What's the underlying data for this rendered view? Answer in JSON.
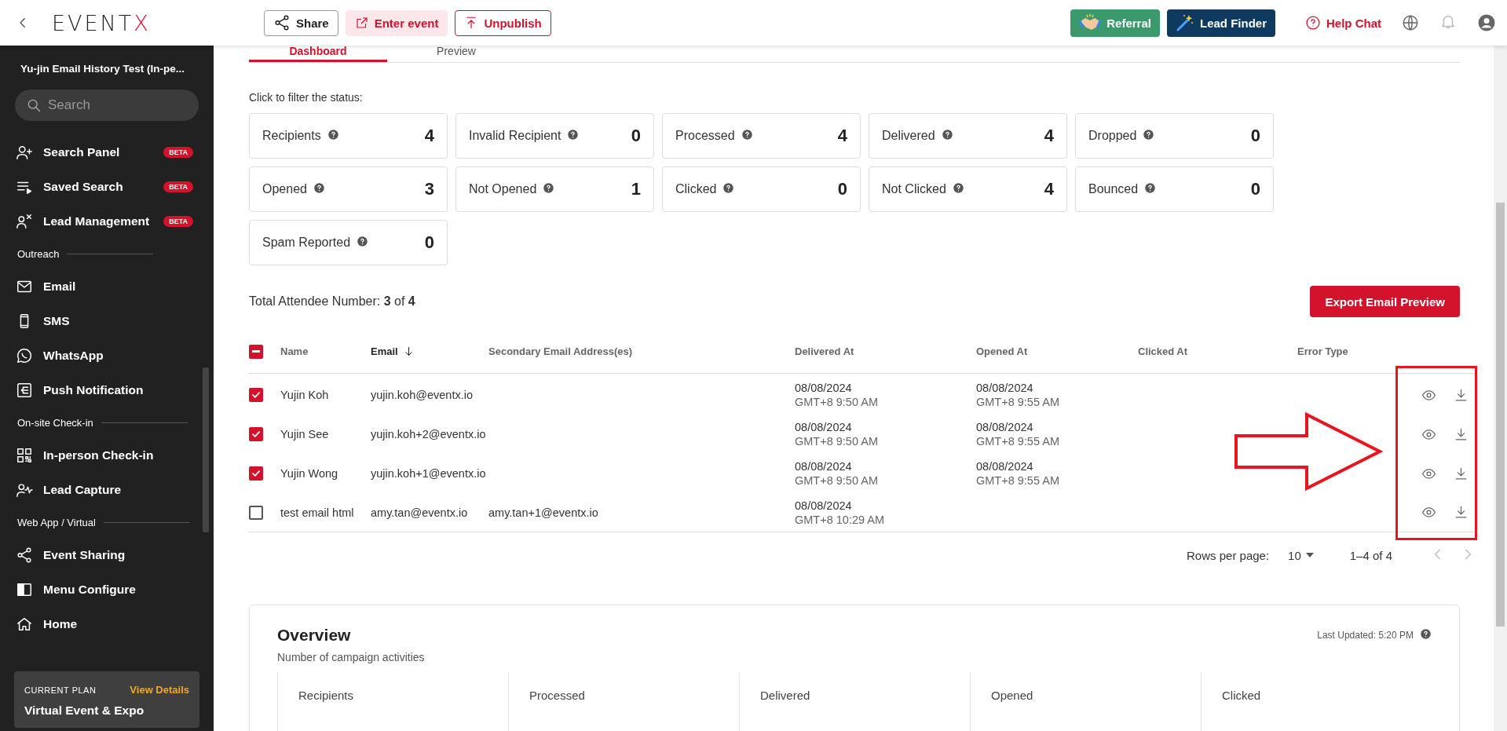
{
  "header": {
    "logo": {
      "text": "EVENT",
      "accent": "X"
    },
    "actions": [
      {
        "label": "Share",
        "kind": "outline"
      },
      {
        "label": "Enter event",
        "kind": "tinted"
      },
      {
        "label": "Unpublish",
        "kind": "danger-outline"
      }
    ],
    "promos": [
      {
        "label": "Referral",
        "kind": "green"
      },
      {
        "label": "Lead Finder",
        "kind": "navy"
      }
    ],
    "help": "Help Chat"
  },
  "sidebar": {
    "event_title": "Yu-jin Email History Test (In-pe...",
    "search": {
      "placeholder": "Search"
    },
    "items": [
      {
        "kind": "item",
        "label": "Search Panel",
        "badge": "BETA"
      },
      {
        "kind": "item",
        "label": "Saved Search",
        "badge": "BETA"
      },
      {
        "kind": "item",
        "label": "Lead Management",
        "badge": "BETA"
      },
      {
        "kind": "section",
        "label": "Outreach"
      },
      {
        "kind": "item",
        "label": "Email"
      },
      {
        "kind": "item",
        "label": "SMS"
      },
      {
        "kind": "item",
        "label": "WhatsApp"
      },
      {
        "kind": "item",
        "label": "Push Notification"
      },
      {
        "kind": "section",
        "label": "On-site Check-in"
      },
      {
        "kind": "item",
        "label": "In-person Check-in"
      },
      {
        "kind": "item",
        "label": "Lead Capture"
      },
      {
        "kind": "section",
        "label": "Web App / Virtual"
      },
      {
        "kind": "item",
        "label": "Event Sharing"
      },
      {
        "kind": "item",
        "label": "Menu Configure"
      },
      {
        "kind": "item",
        "label": "Home"
      }
    ],
    "plan": {
      "caption": "CURRENT PLAN",
      "link": "View Details",
      "name": "Virtual Event & Expo"
    }
  },
  "tabs": [
    {
      "label": "Dashboard",
      "selected": true
    },
    {
      "label": "Preview",
      "selected": false
    }
  ],
  "filter_hint": "Click to filter the status:",
  "stats": [
    {
      "label": "Recipients",
      "value": "4"
    },
    {
      "label": "Invalid Recipient",
      "value": "0"
    },
    {
      "label": "Processed",
      "value": "4"
    },
    {
      "label": "Delivered",
      "value": "4"
    },
    {
      "label": "Dropped",
      "value": "0"
    },
    {
      "label": "Opened",
      "value": "3"
    },
    {
      "label": "Not Opened",
      "value": "1"
    },
    {
      "label": "Clicked",
      "value": "0"
    },
    {
      "label": "Not Clicked",
      "value": "4"
    },
    {
      "label": "Bounced",
      "value": "0"
    },
    {
      "label": "Spam Reported",
      "value": "0"
    }
  ],
  "total": "Total Attendee Number: **3** of **4**",
  "export_button": "Export Email Preview",
  "table": {
    "select_all": {
      "checked": true,
      "partial": true
    },
    "columns": [
      {
        "label": "Name",
        "sorted": false
      },
      {
        "label": "Email",
        "sorted": true
      },
      {
        "label": "Secondary Email Address(es)",
        "sorted": false
      },
      {
        "label": "Delivered At",
        "sorted": false
      },
      {
        "label": "Opened At",
        "sorted": false
      },
      {
        "label": "Clicked At",
        "sorted": false
      },
      {
        "label": "Error Type",
        "sorted": false
      }
    ],
    "rows": [
      {
        "checked": true,
        "name": "Yujin Koh",
        "email": "yujin.koh@eventx.io",
        "delivered": {
          "date": "08/08/2024",
          "time": "GMT+8 9:50 AM"
        },
        "opened": {
          "date": "08/08/2024",
          "time": "GMT+8 9:55 AM"
        }
      },
      {
        "checked": true,
        "name": "Yujin See",
        "email": "yujin.koh+2@eventx.io",
        "delivered": {
          "date": "08/08/2024",
          "time": "GMT+8 9:50 AM"
        },
        "opened": {
          "date": "08/08/2024",
          "time": "GMT+8 9:55 AM"
        }
      },
      {
        "checked": true,
        "name": "Yujin Wong",
        "email": "yujin.koh+1@eventx.io",
        "delivered": {
          "date": "08/08/2024",
          "time": "GMT+8 9:50 AM"
        },
        "opened": {
          "date": "08/08/2024",
          "time": "GMT+8 9:55 AM"
        }
      },
      {
        "checked": false,
        "name": "test email html",
        "email": "amy.tan@eventx.io",
        "secondary": "amy.tan+1@eventx.io",
        "delivered": {
          "date": "08/08/2024",
          "time": "GMT+8 10:29 AM"
        }
      }
    ]
  },
  "pagination": {
    "label": "Rows per page:",
    "rows_per_page": "10",
    "range": "1–4 of 4",
    "prev_disabled": true,
    "next_disabled": true
  },
  "overview": {
    "title": "Overview",
    "subtitle": "Number of campaign activities",
    "last_updated": "Last Updated: 5:20 PM",
    "columns": [
      "Recipients",
      "Processed",
      "Delivered",
      "Opened",
      "Clicked"
    ]
  }
}
